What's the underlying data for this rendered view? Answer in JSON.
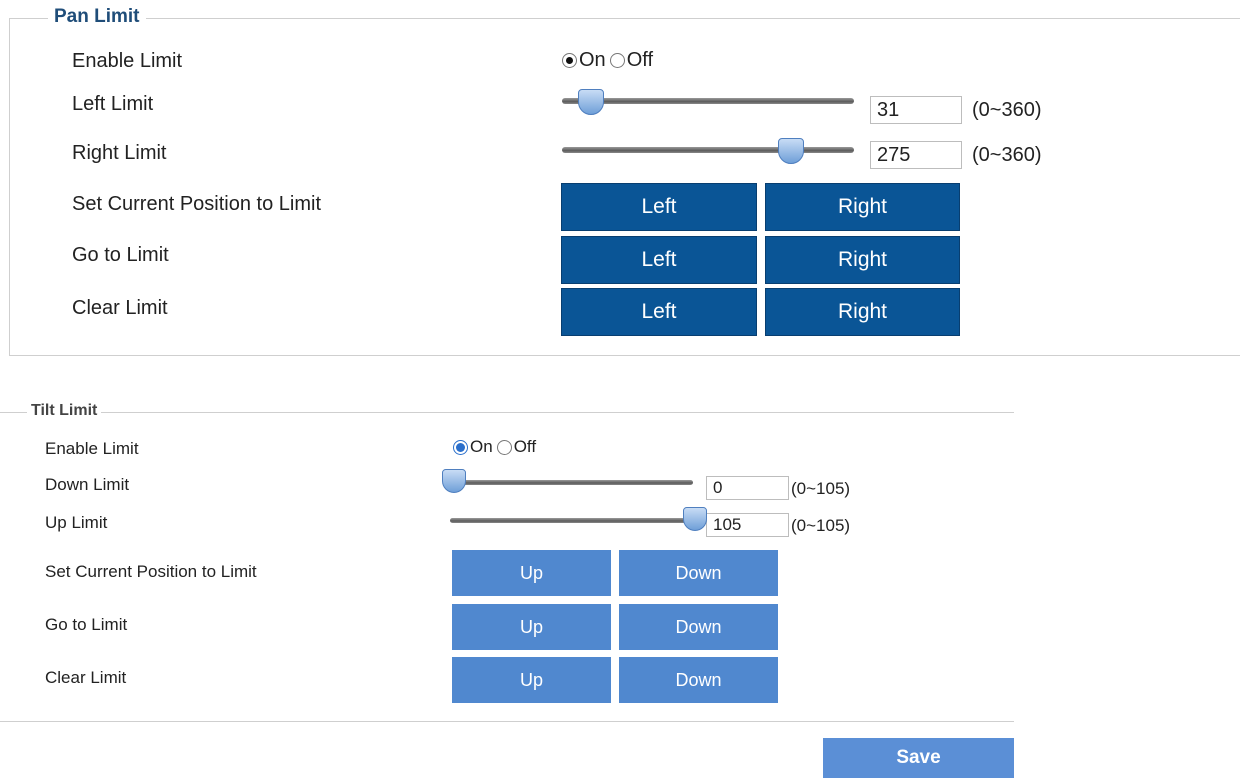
{
  "pan": {
    "legend": "Pan Limit",
    "enable_label": "Enable Limit",
    "on_label": "On",
    "off_label": "Off",
    "enabled": true,
    "left_label": "Left Limit",
    "left_value": "31",
    "left_range": "(0~360)",
    "right_label": "Right Limit",
    "right_value": "275",
    "right_range": "(0~360)",
    "set_label": "Set Current Position to Limit",
    "goto_label": "Go to Limit",
    "clear_label": "Clear Limit",
    "btn_left": "Left",
    "btn_right": "Right"
  },
  "tilt": {
    "legend": "Tilt Limit",
    "enable_label": "Enable Limit",
    "on_label": "On",
    "off_label": "Off",
    "enabled": true,
    "down_label": "Down Limit",
    "down_value": "0",
    "down_range": "(0~105)",
    "up_label": "Up Limit",
    "up_value": "105",
    "up_range": "(0~105)",
    "set_label": "Set Current Position to Limit",
    "goto_label": "Go to Limit",
    "clear_label": "Clear Limit",
    "btn_up": "Up",
    "btn_down": "Down"
  },
  "save_label": "Save",
  "colors": {
    "pan_button": "#0a5596",
    "tilt_button": "#5088cf",
    "save_button": "#5b8fd6",
    "legend_pan": "#1f4d79"
  }
}
